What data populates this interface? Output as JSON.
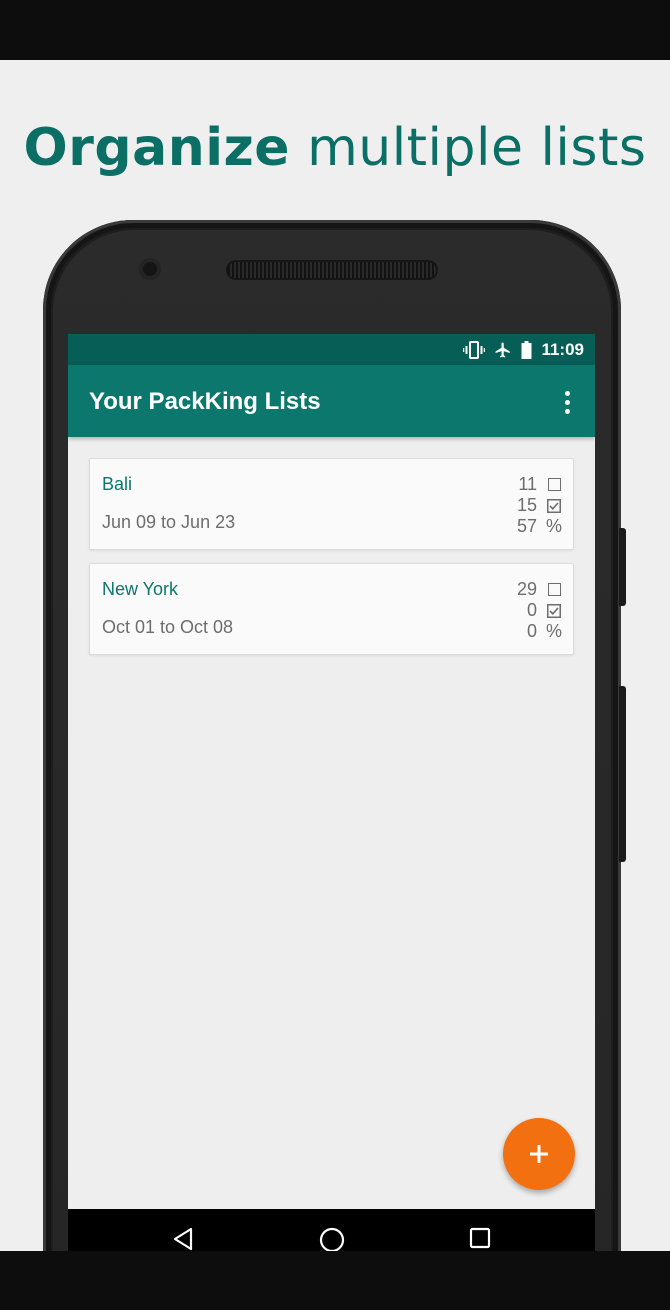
{
  "headline": {
    "bold": "Organize",
    "rest": "multiple lists"
  },
  "status_bar": {
    "time": "11:09",
    "icons": [
      "vibrate-icon",
      "airplane-icon",
      "battery-icon"
    ]
  },
  "app_bar": {
    "title": "Your PackKing Lists",
    "menu_icon": "more-vert-icon"
  },
  "lists": [
    {
      "name": "Bali",
      "dates": "Jun 09 to Jun 23",
      "unchecked": "11",
      "checked": "15",
      "percent": "57",
      "percent_symbol": "%"
    },
    {
      "name": "New York",
      "dates": "Oct 01 to Oct 08",
      "unchecked": "29",
      "checked": "0",
      "percent": "0",
      "percent_symbol": "%"
    }
  ],
  "fab": {
    "icon": "plus-icon"
  },
  "nav_bar": {
    "icons": [
      "back-icon",
      "home-icon",
      "recents-icon"
    ]
  },
  "colors": {
    "primary": "#0c776d",
    "primary_dark": "#075e56",
    "accent": "#f2700f",
    "background": "#eeeeee"
  }
}
